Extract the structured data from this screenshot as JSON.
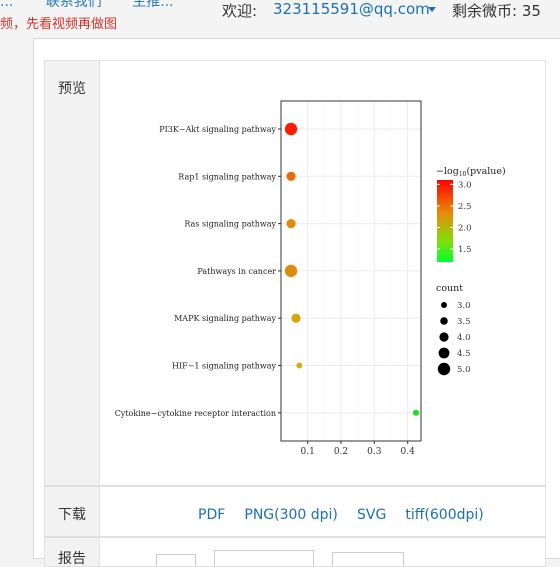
{
  "header": {
    "nav_fragments": [
      "...",
      "联系我们",
      "主推...",
      "..."
    ],
    "hint": "频，先看视频再做图",
    "welcome_label": "欢迎:",
    "user_email": "323115591@qq.com",
    "coins_label": "剩余微币: 35"
  },
  "preview_label": "预览",
  "download_label": "下载",
  "downloads": [
    "PDF",
    "PNG(300 dpi)",
    "SVG",
    "tiff(600dpi)"
  ],
  "next_label": "报告",
  "chart_data": {
    "type": "scatter",
    "title": "",
    "xlabel": "",
    "ylabel": "",
    "x_ticks": [
      "0.1",
      "0.2",
      "0.3",
      "0.4"
    ],
    "xlim": [
      0.02,
      0.44
    ],
    "categories": [
      "PI3K−Akt signaling pathway",
      "Rap1 signaling pathway",
      "Ras signaling pathway",
      "Pathways in cancer",
      "MAPK signaling pathway",
      "HIF−1 signaling pathway",
      "Cytokine−cytokine receptor interaction"
    ],
    "points": [
      {
        "term": "PI3K−Akt signaling pathway",
        "x": 0.05,
        "count": 5,
        "neglog10p": 3.1,
        "color": "#ff1a00"
      },
      {
        "term": "Rap1 signaling pathway",
        "x": 0.05,
        "count": 4,
        "neglog10p": 2.8,
        "color": "#e96c08"
      },
      {
        "term": "Ras signaling pathway",
        "x": 0.05,
        "count": 4,
        "neglog10p": 2.6,
        "color": "#e38a0a"
      },
      {
        "term": "Pathways in cancer",
        "x": 0.05,
        "count": 5,
        "neglog10p": 2.5,
        "color": "#dd8d0a"
      },
      {
        "term": "MAPK signaling pathway",
        "x": 0.065,
        "count": 4,
        "neglog10p": 2.3,
        "color": "#d4a80a"
      },
      {
        "term": "HIF−1 signaling pathway",
        "x": 0.075,
        "count": 3,
        "neglog10p": 2.3,
        "color": "#d1b00e"
      },
      {
        "term": "Cytokine−cytokine receptor interaction",
        "x": 0.425,
        "count": 3,
        "neglog10p": 1.3,
        "color": "#18e018"
      }
    ],
    "color_legend": {
      "title": "−log",
      "title_sub": "10",
      "title_rest": "(pvalue)",
      "ticks": [
        "3.0",
        "2.5",
        "2.0",
        "1.5"
      ],
      "range": [
        1.2,
        3.1
      ],
      "gradient": [
        "#ff0000",
        "#e98a0a",
        "#7fe00a",
        "#00ff33"
      ]
    },
    "size_legend": {
      "title": "count",
      "values": [
        "3.0",
        "3.5",
        "4.0",
        "4.5",
        "5.0"
      ]
    }
  }
}
